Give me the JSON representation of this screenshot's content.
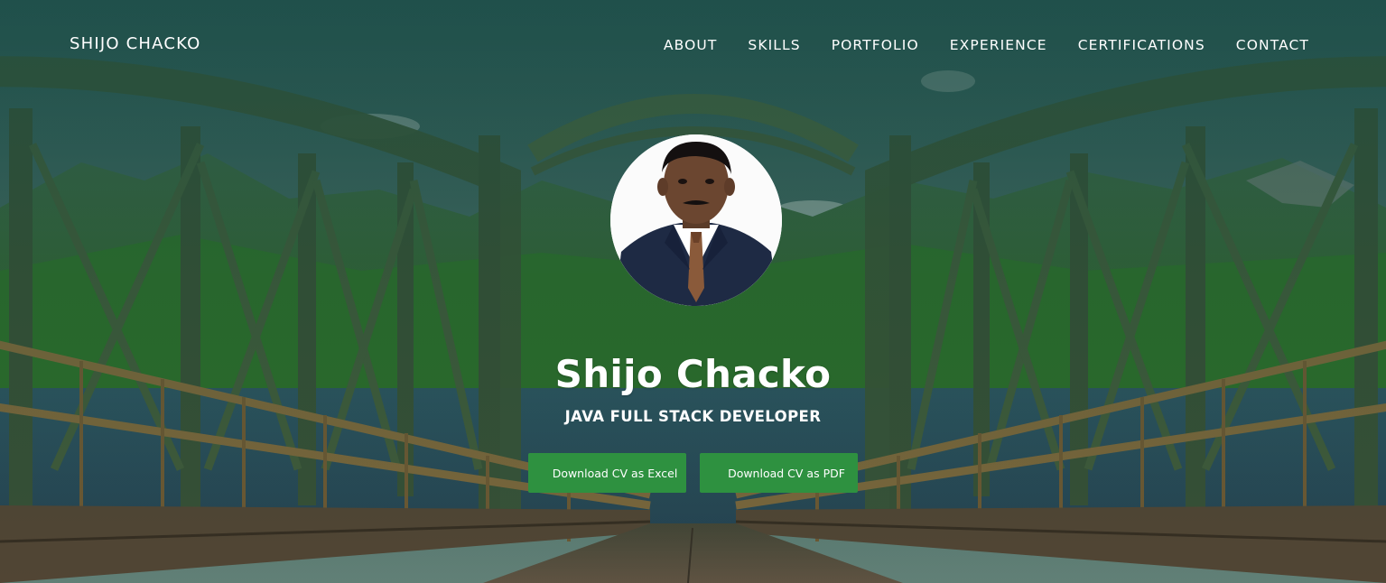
{
  "brand": "SHIJO CHACKO",
  "nav": {
    "items": [
      {
        "label": "ABOUT"
      },
      {
        "label": "SKILLS"
      },
      {
        "label": "PORTFOLIO"
      },
      {
        "label": "EXPERIENCE"
      },
      {
        "label": "CERTIFICATIONS"
      },
      {
        "label": "CONTACT"
      }
    ]
  },
  "hero": {
    "name": "Shijo Chacko",
    "role": "JAVA FULL STACK DEVELOPER",
    "buttons": {
      "excel_label": "Download CV as Excel",
      "pdf_label": "Download CV as PDF"
    }
  },
  "colors": {
    "button_bg": "#2e9140",
    "overlay": "#164840",
    "text": "#ffffff"
  }
}
